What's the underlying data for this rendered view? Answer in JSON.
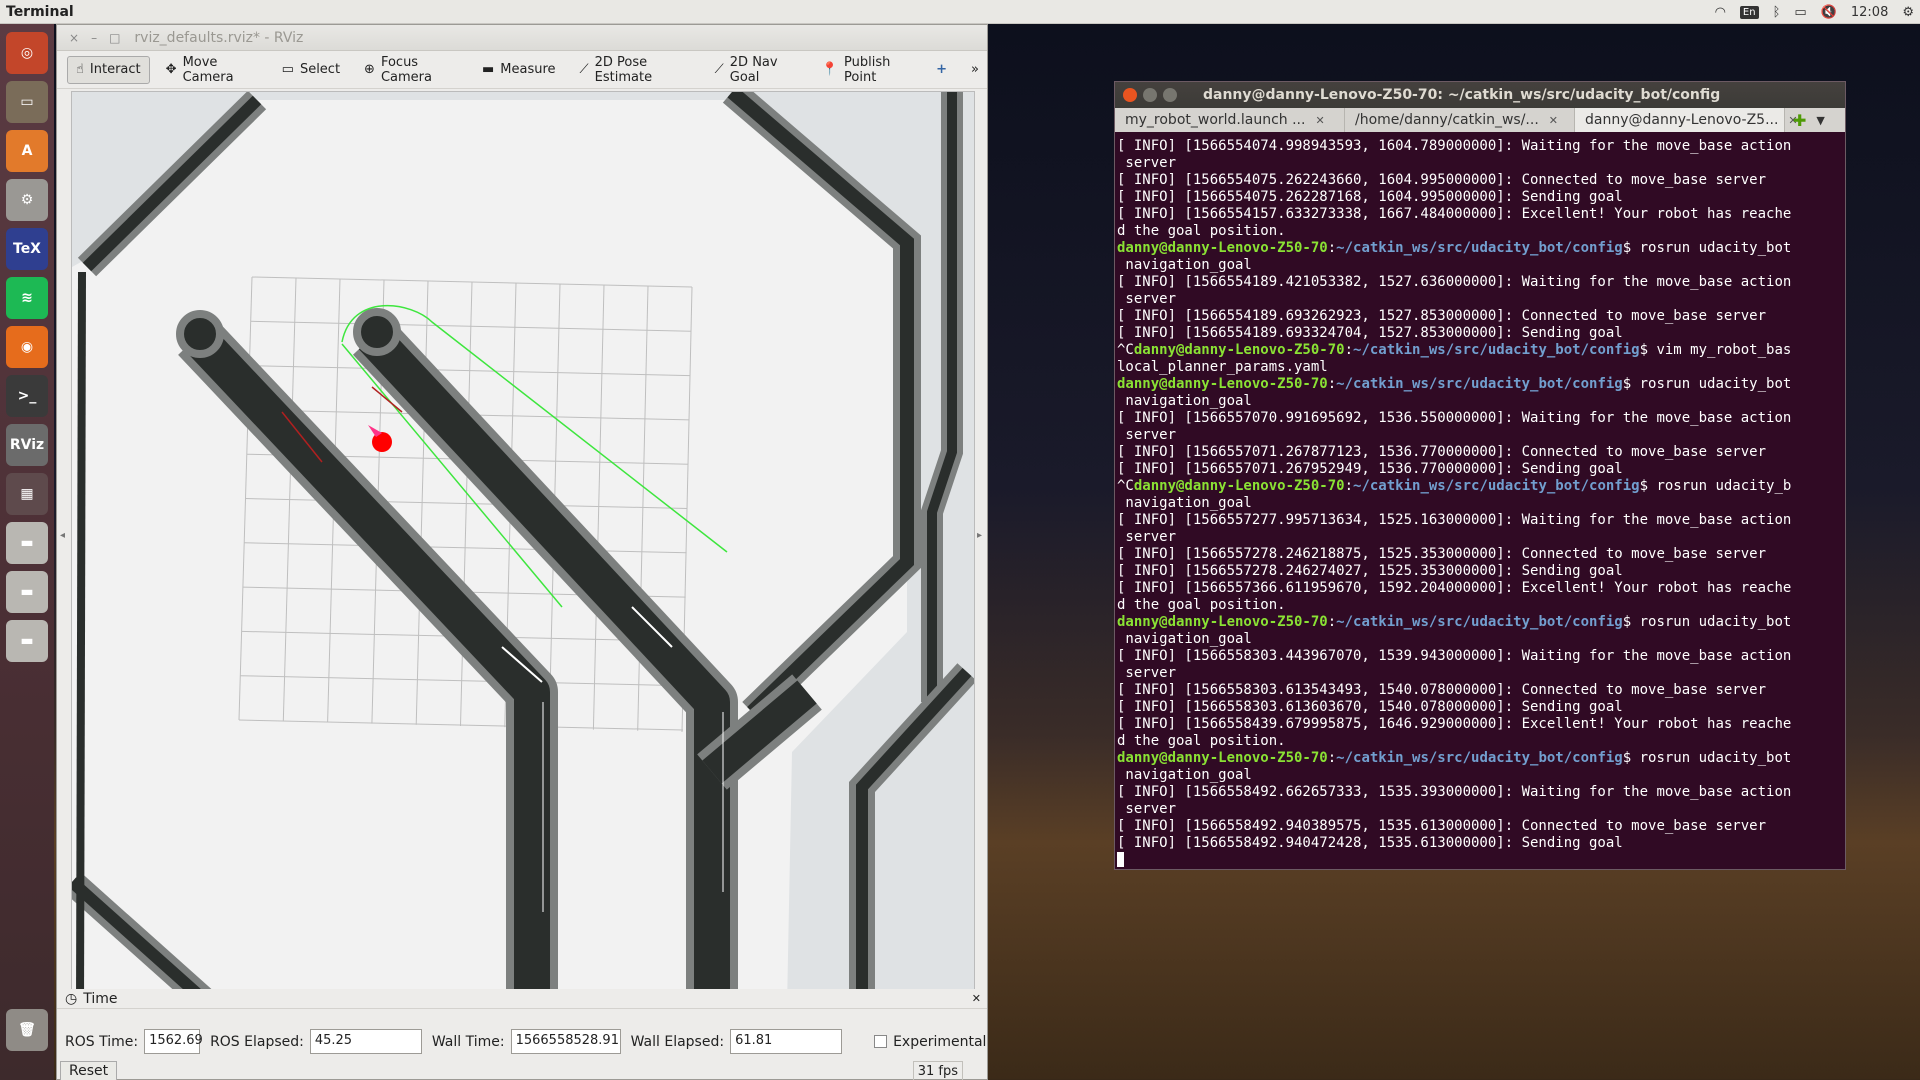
{
  "topbar": {
    "app_title": "Terminal",
    "keyboard": "En",
    "clock": "12:08",
    "icons": [
      "wifi-icon",
      "keyboard-layout-indicator",
      "bluetooth-icon",
      "battery-icon",
      "volume-mute-icon",
      "settings-gear-icon"
    ]
  },
  "launcher": {
    "items": [
      {
        "name": "ubuntu-dash-icon",
        "glyph": "◎",
        "color": "#c3462a"
      },
      {
        "name": "files-icon",
        "glyph": "▭",
        "color": "#7a6c59"
      },
      {
        "name": "software-center-icon",
        "glyph": "A",
        "color": "#e27a2b"
      },
      {
        "name": "system-settings-icon",
        "glyph": "⚙",
        "color": "#9a9894"
      },
      {
        "name": "texmaker-icon",
        "glyph": "TeX",
        "color": "#2f3f90"
      },
      {
        "name": "spotify-icon",
        "glyph": "≋",
        "color": "#1db954"
      },
      {
        "name": "firefox-icon",
        "glyph": "◉",
        "color": "#e66c1c"
      },
      {
        "name": "terminal-icon",
        "glyph": ">_",
        "color": "#3a3a3a"
      },
      {
        "name": "rviz-icon",
        "glyph": "RViz",
        "color": "#6b6b6b"
      },
      {
        "name": "workspace-switcher-icon",
        "glyph": "▦",
        "color": "#5e4a4c"
      },
      {
        "name": "drive-icon-1",
        "glyph": "▬",
        "color": "#b9b7b2"
      },
      {
        "name": "drive-icon-2",
        "glyph": "▬",
        "color": "#b9b7b2"
      },
      {
        "name": "drive-icon-3",
        "glyph": "▬",
        "color": "#b9b7b2"
      },
      {
        "name": "trash-icon",
        "glyph": "🗑",
        "color": "#8f8b86"
      }
    ]
  },
  "rviz": {
    "window_title": "rviz_defaults.rviz* - RViz",
    "window_buttons": [
      "×",
      "–",
      "□"
    ],
    "tools": [
      {
        "label": "Interact",
        "icon": "interact-icon",
        "glyph": "☝",
        "active": true
      },
      {
        "label": "Move Camera",
        "icon": "move-camera-icon",
        "glyph": "✥",
        "active": false
      },
      {
        "label": "Select",
        "icon": "select-icon",
        "glyph": "▭",
        "active": false
      },
      {
        "label": "Focus Camera",
        "icon": "focus-camera-icon",
        "glyph": "⊕",
        "active": false
      },
      {
        "label": "Measure",
        "icon": "measure-icon",
        "glyph": "▬",
        "active": false
      },
      {
        "label": "2D Pose Estimate",
        "icon": "pose-estimate-icon",
        "glyph": "⟋",
        "active": false
      },
      {
        "label": "2D Nav Goal",
        "icon": "nav-goal-icon",
        "glyph": "⟋",
        "active": false
      },
      {
        "label": "Publish Point",
        "icon": "publish-point-icon",
        "glyph": "📍",
        "active": false
      }
    ],
    "add_tool_glyph": "+",
    "overflow_glyph": "»",
    "time_panel": {
      "title": "Time",
      "ros_time_label": "ROS Time:",
      "ros_time": "1562.69",
      "ros_elapsed_label": "ROS Elapsed:",
      "ros_elapsed": "45.25",
      "wall_time_label": "Wall Time:",
      "wall_time": "1566558528.91",
      "wall_elapsed_label": "Wall Elapsed:",
      "wall_elapsed": "61.81",
      "experimental_label": "Experimental",
      "reset_label": "Reset",
      "fps": "31 fps"
    }
  },
  "terminal": {
    "title": "danny@danny-Lenovo-Z50-70: ~/catkin_ws/src/udacity_bot/config",
    "tabs": [
      {
        "label": "my_robot_world.launch ...",
        "active": false
      },
      {
        "label": "/home/danny/catkin_ws/...",
        "active": false
      },
      {
        "label": "danny@danny-Lenovo-Z5...",
        "active": true
      }
    ],
    "prompt_user": "danny@danny-Lenovo-Z50-70",
    "prompt_path": "~/catkin_ws/src/udacity_bot/config",
    "lines": [
      {
        "t": "out",
        "text": "[ INFO] [1566554074.998943593, 1604.789000000]: Waiting for the move_base action"
      },
      {
        "t": "out",
        "text": " server"
      },
      {
        "t": "out",
        "text": "[ INFO] [1566554075.262243660, 1604.995000000]: Connected to move_base server"
      },
      {
        "t": "out",
        "text": "[ INFO] [1566554075.262287168, 1604.995000000]: Sending goal"
      },
      {
        "t": "out",
        "text": "[ INFO] [1566554157.633273338, 1667.484000000]: Excellent! Your robot has reache"
      },
      {
        "t": "out",
        "text": "d the goal position."
      },
      {
        "t": "prompt",
        "pre": "",
        "cmd": "$ rosrun udacity_bot"
      },
      {
        "t": "out",
        "text": " navigation_goal"
      },
      {
        "t": "out",
        "text": "[ INFO] [1566554189.421053382, 1527.636000000]: Waiting for the move_base action"
      },
      {
        "t": "out",
        "text": " server"
      },
      {
        "t": "out",
        "text": "[ INFO] [1566554189.693262923, 1527.853000000]: Connected to move_base server"
      },
      {
        "t": "out",
        "text": "[ INFO] [1566554189.693324704, 1527.853000000]: Sending goal"
      },
      {
        "t": "prompt",
        "pre": "^C",
        "cmd": "$ vim my_robot_bas"
      },
      {
        "t": "out",
        "text": "local_planner_params.yaml"
      },
      {
        "t": "prompt",
        "pre": "",
        "cmd": "$ rosrun udacity_bot"
      },
      {
        "t": "out",
        "text": " navigation_goal"
      },
      {
        "t": "out",
        "text": "[ INFO] [1566557070.991695692, 1536.550000000]: Waiting for the move_base action"
      },
      {
        "t": "out",
        "text": " server"
      },
      {
        "t": "out",
        "text": "[ INFO] [1566557071.267877123, 1536.770000000]: Connected to move_base server"
      },
      {
        "t": "out",
        "text": "[ INFO] [1566557071.267952949, 1536.770000000]: Sending goal"
      },
      {
        "t": "prompt",
        "pre": "^C",
        "cmd": "$ rosrun udacity_b"
      },
      {
        "t": "out",
        "text": " navigation_goal"
      },
      {
        "t": "out",
        "text": "[ INFO] [1566557277.995713634, 1525.163000000]: Waiting for the move_base action"
      },
      {
        "t": "out",
        "text": " server"
      },
      {
        "t": "out",
        "text": "[ INFO] [1566557278.246218875, 1525.353000000]: Connected to move_base server"
      },
      {
        "t": "out",
        "text": "[ INFO] [1566557278.246274027, 1525.353000000]: Sending goal"
      },
      {
        "t": "out",
        "text": "[ INFO] [1566557366.611959670, 1592.204000000]: Excellent! Your robot has reache"
      },
      {
        "t": "out",
        "text": "d the goal position."
      },
      {
        "t": "prompt",
        "pre": "",
        "cmd": "$ rosrun udacity_bot"
      },
      {
        "t": "out",
        "text": " navigation_goal"
      },
      {
        "t": "out",
        "text": "[ INFO] [1566558303.443967070, 1539.943000000]: Waiting for the move_base action"
      },
      {
        "t": "out",
        "text": " server"
      },
      {
        "t": "out",
        "text": "[ INFO] [1566558303.613543493, 1540.078000000]: Connected to move_base server"
      },
      {
        "t": "out",
        "text": "[ INFO] [1566558303.613603670, 1540.078000000]: Sending goal"
      },
      {
        "t": "out",
        "text": "[ INFO] [1566558439.679995875, 1646.929000000]: Excellent! Your robot has reache"
      },
      {
        "t": "out",
        "text": "d the goal position."
      },
      {
        "t": "prompt",
        "pre": "",
        "cmd": "$ rosrun udacity_bot"
      },
      {
        "t": "out",
        "text": " navigation_goal"
      },
      {
        "t": "out",
        "text": "[ INFO] [1566558492.662657333, 1535.393000000]: Waiting for the move_base action"
      },
      {
        "t": "out",
        "text": " server"
      },
      {
        "t": "out",
        "text": "[ INFO] [1566558492.940389575, 1535.613000000]: Connected to move_base server"
      },
      {
        "t": "out",
        "text": "[ INFO] [1566558492.940472428, 1535.613000000]: Sending goal"
      }
    ]
  },
  "colors": {
    "terminal_bg": "#300a24",
    "prompt_user": "#8ae234",
    "prompt_path": "#729fcf",
    "map_wall": "#2a2e2c",
    "map_inflation": "#7d807f",
    "path_green": "#3ee63e",
    "robot_red": "#ff0000"
  }
}
